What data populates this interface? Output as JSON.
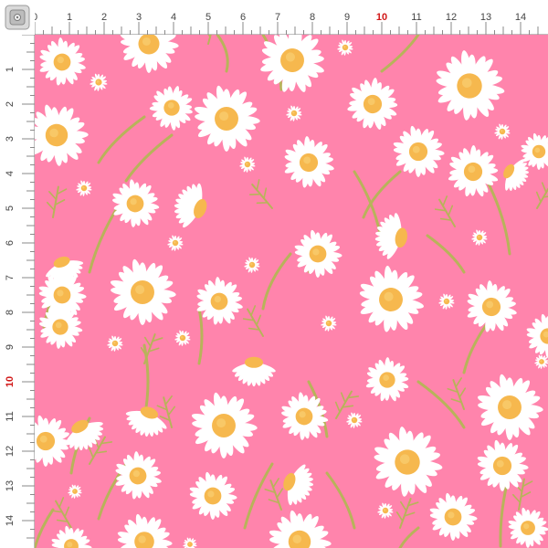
{
  "ruler": {
    "top_labels": [
      "0",
      "1",
      "2",
      "3",
      "4",
      "5",
      "6",
      "7",
      "8",
      "9",
      "10",
      "11",
      "12",
      "13",
      "14"
    ],
    "left_labels": [
      "1",
      "2",
      "3",
      "4",
      "5",
      "6",
      "7",
      "8",
      "9",
      "10",
      "11",
      "12",
      "13",
      "14"
    ],
    "highlight_label": "10",
    "highlight_color": "#d11818",
    "tick_color": "#8a8a8a"
  },
  "fabric": {
    "background_color": "#ff84ac",
    "petal_color": "#ffffff",
    "center_color": "#f6b84e",
    "stem_color": "#b8b35a",
    "motif": "daisy"
  },
  "icons": {
    "corner": "ruler-corner-clip-icon"
  }
}
